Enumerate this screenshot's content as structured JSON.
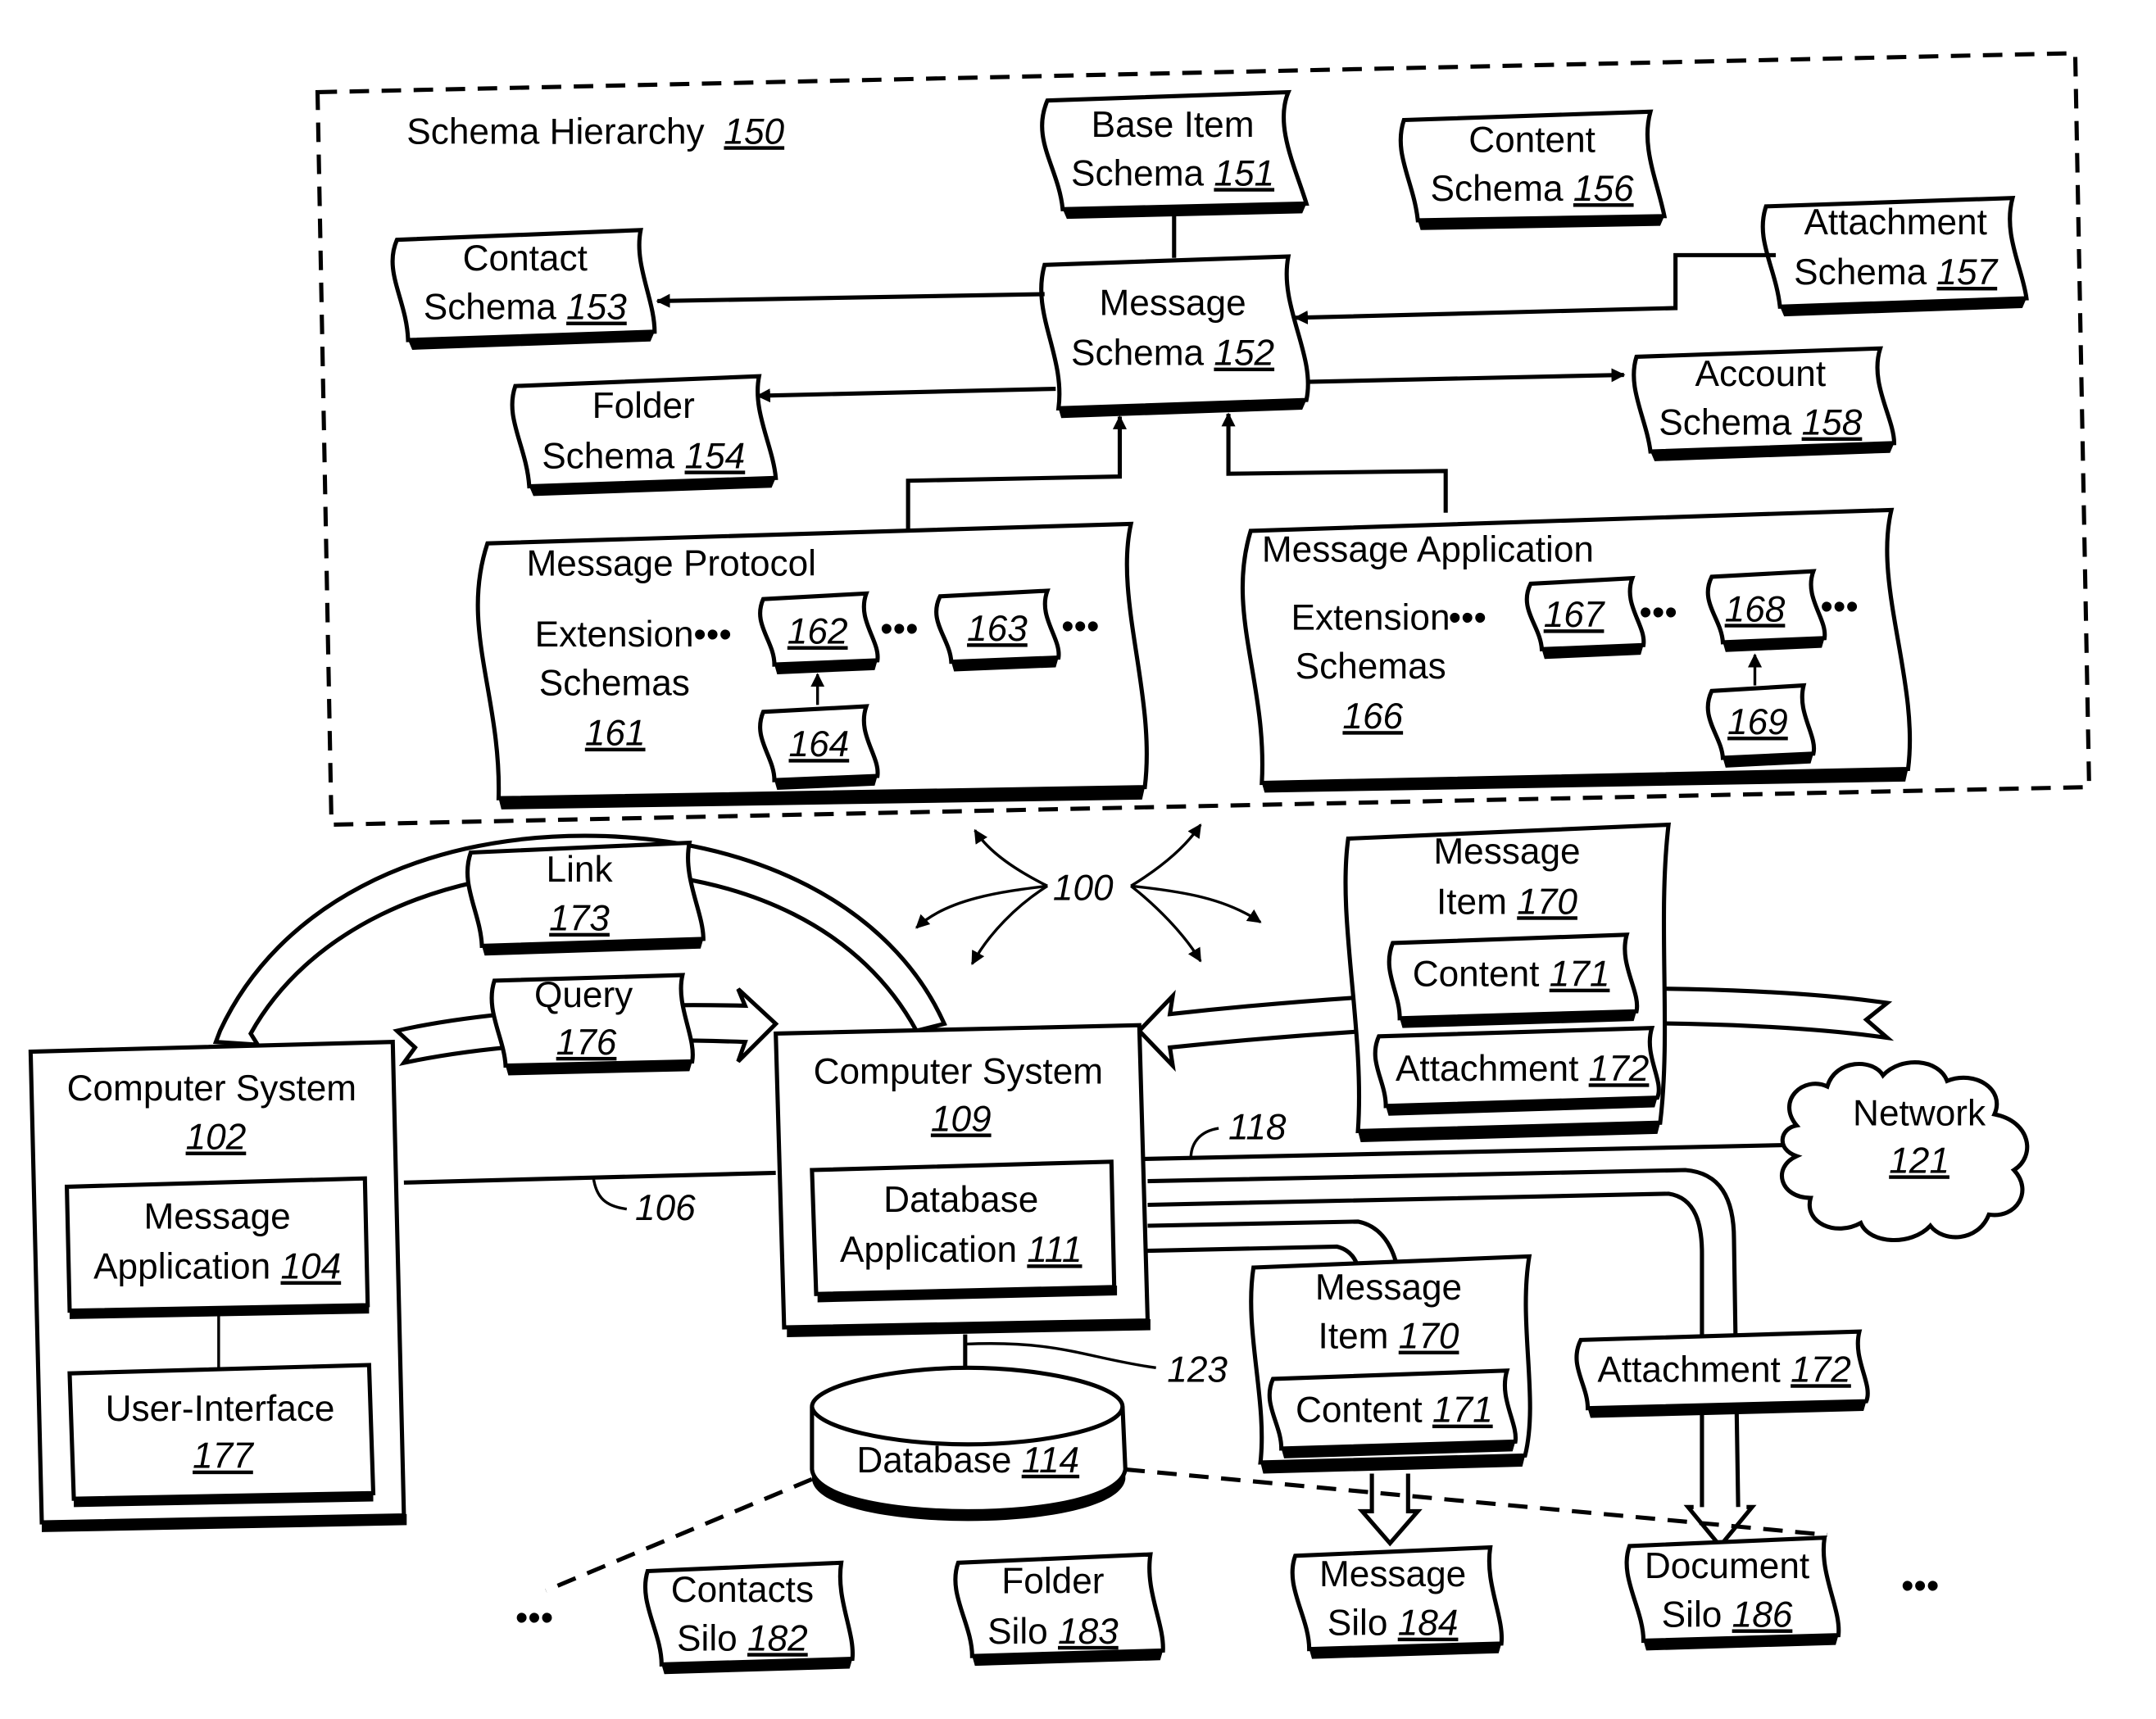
{
  "diagram": {
    "schema_hierarchy": {
      "label": "Schema Hierarchy",
      "ref": "150"
    },
    "schemas": {
      "base_item": {
        "line1": "Base Item",
        "line2": "Schema",
        "ref": "151"
      },
      "message": {
        "line1": "Message",
        "line2": "Schema",
        "ref": "152"
      },
      "contact": {
        "line1": "Contact",
        "line2": "Schema",
        "ref": "153"
      },
      "folder": {
        "line1": "Folder",
        "line2": "Schema",
        "ref": "154"
      },
      "content": {
        "line1": "Content",
        "line2": "Schema",
        "ref": "156"
      },
      "attachment": {
        "line1": "Attachment",
        "line2": "Schema",
        "ref": "157"
      },
      "account": {
        "line1": "Account",
        "line2": "Schema",
        "ref": "158"
      }
    },
    "protocol_ext": {
      "title": "Message Protocol",
      "line1": "Extension",
      "line2": "Schemas",
      "ref": "161",
      "items": [
        "162",
        "163",
        "164"
      ]
    },
    "application_ext": {
      "title": "Message Application",
      "line1": "Extension",
      "line2": "Schemas",
      "ref": "166",
      "items": [
        "167",
        "168",
        "169"
      ]
    },
    "ellipsis": "•••",
    "system_ref": "100",
    "link": {
      "label": "Link",
      "ref": "173"
    },
    "query": {
      "label": "Query",
      "ref": "176"
    },
    "computer_102": {
      "line1": "Computer System",
      "ref": "102"
    },
    "message_app": {
      "line1": "Message",
      "line2": "Application",
      "ref": "104"
    },
    "user_interface": {
      "line1": "User-Interface",
      "ref": "177"
    },
    "computer_109": {
      "line1": "Computer System",
      "ref": "109"
    },
    "database_app": {
      "line1": "Database",
      "line2": "Application",
      "ref": "111"
    },
    "database": {
      "label": "Database",
      "ref": "114"
    },
    "message_item_top": {
      "line1": "Message",
      "line2": "Item",
      "ref": "170",
      "content": {
        "label": "Content",
        "ref": "171"
      },
      "attachment": {
        "label": "Attachment",
        "ref": "172"
      }
    },
    "message_item_bottom": {
      "line1": "Message",
      "line2": "Item",
      "ref": "170",
      "content": {
        "label": "Content",
        "ref": "171"
      }
    },
    "attachment_bottom": {
      "label": "Attachment",
      "ref": "172"
    },
    "network": {
      "label": "Network",
      "ref": "121"
    },
    "connectors": {
      "lan": "106",
      "wan": "118",
      "db_link": "123"
    },
    "silos": [
      {
        "line1": "Contacts",
        "line2": "Silo",
        "ref": "182"
      },
      {
        "line1": "Folder",
        "line2": "Silo",
        "ref": "183"
      },
      {
        "line1": "Message",
        "line2": "Silo",
        "ref": "184"
      },
      {
        "line1": "Document",
        "line2": "Silo",
        "ref": "186"
      }
    ]
  }
}
